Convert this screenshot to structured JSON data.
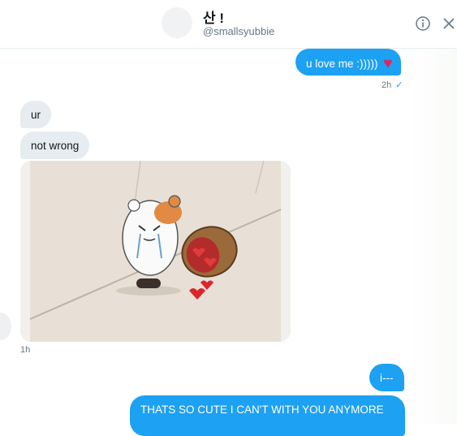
{
  "header": {
    "display_name": "산 !",
    "handle": "@smallsyubbie"
  },
  "icons": {
    "info": "info-icon",
    "close": "close-icon",
    "heart": "heart-icon",
    "read_receipt": "checkmark-icon"
  },
  "colors": {
    "outgoing_bubble": "#1da1f2",
    "incoming_bubble": "#e6ecf0",
    "heart": "#e0245e"
  },
  "messages": [
    {
      "direction": "outgoing",
      "text": "u love me :)))))",
      "emoji": "♥"
    },
    {
      "direction": "outgoing_meta",
      "time": "2h",
      "status": "✓"
    },
    {
      "direction": "incoming",
      "text": "ur"
    },
    {
      "direction": "incoming",
      "text": "not wrong"
    },
    {
      "direction": "incoming_media",
      "time": "1h"
    },
    {
      "direction": "outgoing",
      "text": "i---"
    },
    {
      "direction": "outgoing",
      "text": "THATS SO CUTE I CAN'T WITH YOU ANYMORE"
    }
  ]
}
